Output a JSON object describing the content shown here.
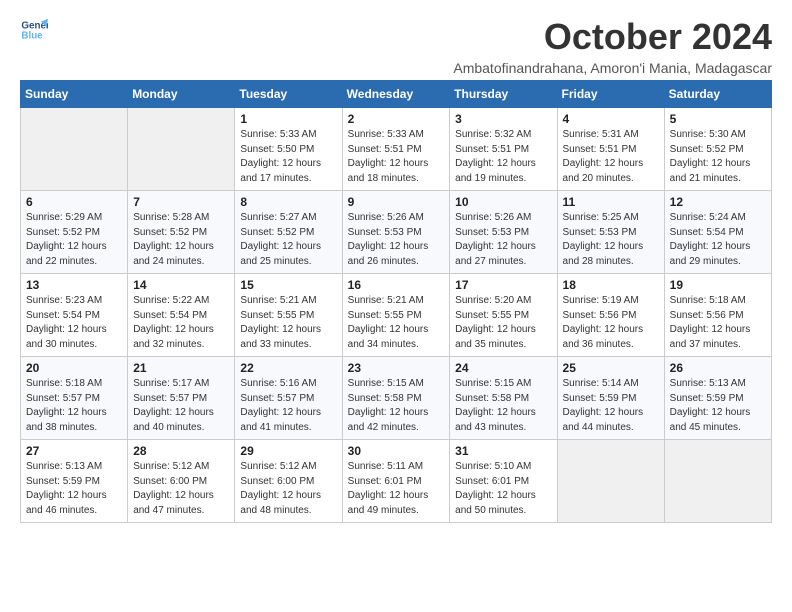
{
  "logo": {
    "line1": "General",
    "line2": "Blue"
  },
  "title": "October 2024",
  "subtitle": "Ambatofinandrahana, Amoron'i Mania, Madagascar",
  "days_of_week": [
    "Sunday",
    "Monday",
    "Tuesday",
    "Wednesday",
    "Thursday",
    "Friday",
    "Saturday"
  ],
  "weeks": [
    [
      {
        "day": "",
        "info": ""
      },
      {
        "day": "",
        "info": ""
      },
      {
        "day": "1",
        "info": "Sunrise: 5:33 AM\nSunset: 5:50 PM\nDaylight: 12 hours and 17 minutes."
      },
      {
        "day": "2",
        "info": "Sunrise: 5:33 AM\nSunset: 5:51 PM\nDaylight: 12 hours and 18 minutes."
      },
      {
        "day": "3",
        "info": "Sunrise: 5:32 AM\nSunset: 5:51 PM\nDaylight: 12 hours and 19 minutes."
      },
      {
        "day": "4",
        "info": "Sunrise: 5:31 AM\nSunset: 5:51 PM\nDaylight: 12 hours and 20 minutes."
      },
      {
        "day": "5",
        "info": "Sunrise: 5:30 AM\nSunset: 5:52 PM\nDaylight: 12 hours and 21 minutes."
      }
    ],
    [
      {
        "day": "6",
        "info": "Sunrise: 5:29 AM\nSunset: 5:52 PM\nDaylight: 12 hours and 22 minutes."
      },
      {
        "day": "7",
        "info": "Sunrise: 5:28 AM\nSunset: 5:52 PM\nDaylight: 12 hours and 24 minutes."
      },
      {
        "day": "8",
        "info": "Sunrise: 5:27 AM\nSunset: 5:52 PM\nDaylight: 12 hours and 25 minutes."
      },
      {
        "day": "9",
        "info": "Sunrise: 5:26 AM\nSunset: 5:53 PM\nDaylight: 12 hours and 26 minutes."
      },
      {
        "day": "10",
        "info": "Sunrise: 5:26 AM\nSunset: 5:53 PM\nDaylight: 12 hours and 27 minutes."
      },
      {
        "day": "11",
        "info": "Sunrise: 5:25 AM\nSunset: 5:53 PM\nDaylight: 12 hours and 28 minutes."
      },
      {
        "day": "12",
        "info": "Sunrise: 5:24 AM\nSunset: 5:54 PM\nDaylight: 12 hours and 29 minutes."
      }
    ],
    [
      {
        "day": "13",
        "info": "Sunrise: 5:23 AM\nSunset: 5:54 PM\nDaylight: 12 hours and 30 minutes."
      },
      {
        "day": "14",
        "info": "Sunrise: 5:22 AM\nSunset: 5:54 PM\nDaylight: 12 hours and 32 minutes."
      },
      {
        "day": "15",
        "info": "Sunrise: 5:21 AM\nSunset: 5:55 PM\nDaylight: 12 hours and 33 minutes."
      },
      {
        "day": "16",
        "info": "Sunrise: 5:21 AM\nSunset: 5:55 PM\nDaylight: 12 hours and 34 minutes."
      },
      {
        "day": "17",
        "info": "Sunrise: 5:20 AM\nSunset: 5:55 PM\nDaylight: 12 hours and 35 minutes."
      },
      {
        "day": "18",
        "info": "Sunrise: 5:19 AM\nSunset: 5:56 PM\nDaylight: 12 hours and 36 minutes."
      },
      {
        "day": "19",
        "info": "Sunrise: 5:18 AM\nSunset: 5:56 PM\nDaylight: 12 hours and 37 minutes."
      }
    ],
    [
      {
        "day": "20",
        "info": "Sunrise: 5:18 AM\nSunset: 5:57 PM\nDaylight: 12 hours and 38 minutes."
      },
      {
        "day": "21",
        "info": "Sunrise: 5:17 AM\nSunset: 5:57 PM\nDaylight: 12 hours and 40 minutes."
      },
      {
        "day": "22",
        "info": "Sunrise: 5:16 AM\nSunset: 5:57 PM\nDaylight: 12 hours and 41 minutes."
      },
      {
        "day": "23",
        "info": "Sunrise: 5:15 AM\nSunset: 5:58 PM\nDaylight: 12 hours and 42 minutes."
      },
      {
        "day": "24",
        "info": "Sunrise: 5:15 AM\nSunset: 5:58 PM\nDaylight: 12 hours and 43 minutes."
      },
      {
        "day": "25",
        "info": "Sunrise: 5:14 AM\nSunset: 5:59 PM\nDaylight: 12 hours and 44 minutes."
      },
      {
        "day": "26",
        "info": "Sunrise: 5:13 AM\nSunset: 5:59 PM\nDaylight: 12 hours and 45 minutes."
      }
    ],
    [
      {
        "day": "27",
        "info": "Sunrise: 5:13 AM\nSunset: 5:59 PM\nDaylight: 12 hours and 46 minutes."
      },
      {
        "day": "28",
        "info": "Sunrise: 5:12 AM\nSunset: 6:00 PM\nDaylight: 12 hours and 47 minutes."
      },
      {
        "day": "29",
        "info": "Sunrise: 5:12 AM\nSunset: 6:00 PM\nDaylight: 12 hours and 48 minutes."
      },
      {
        "day": "30",
        "info": "Sunrise: 5:11 AM\nSunset: 6:01 PM\nDaylight: 12 hours and 49 minutes."
      },
      {
        "day": "31",
        "info": "Sunrise: 5:10 AM\nSunset: 6:01 PM\nDaylight: 12 hours and 50 minutes."
      },
      {
        "day": "",
        "info": ""
      },
      {
        "day": "",
        "info": ""
      }
    ]
  ]
}
